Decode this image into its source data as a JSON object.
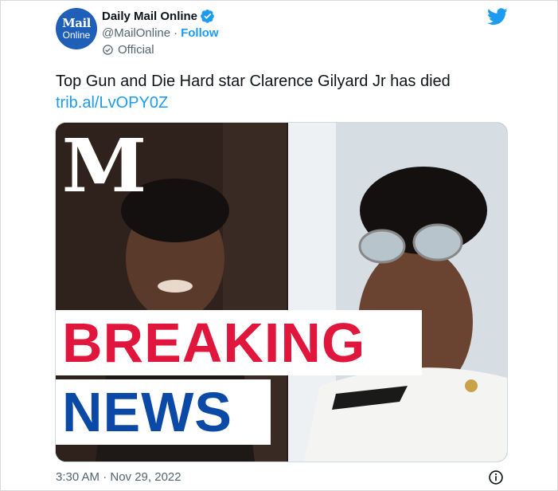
{
  "account": {
    "avatar_line1": "Mail",
    "avatar_line2": "Online",
    "display_name": "Daily Mail Online",
    "handle": "@MailOnline",
    "separator": "·",
    "follow_label": "Follow",
    "official_label": "Official"
  },
  "tweet": {
    "text": "Top Gun and Die Hard star Clarence Gilyard Jr has died",
    "link": "trib.al/LvOPY0Z"
  },
  "media": {
    "logo_text": "M",
    "banner_line1": "BREAKING",
    "banner_line2": "NEWS"
  },
  "meta": {
    "timestamp": "3:30 AM · Nov 29, 2022"
  },
  "icons": {
    "verified": "verified-badge-icon",
    "official": "official-check-icon",
    "brand": "twitter-bird-icon",
    "info": "info-icon"
  },
  "colors": {
    "accent": "#1d9bf0",
    "breaking_red": "#e0163c",
    "news_blue": "#0a4aa6",
    "avatar_blue": "#1f5fb8"
  }
}
